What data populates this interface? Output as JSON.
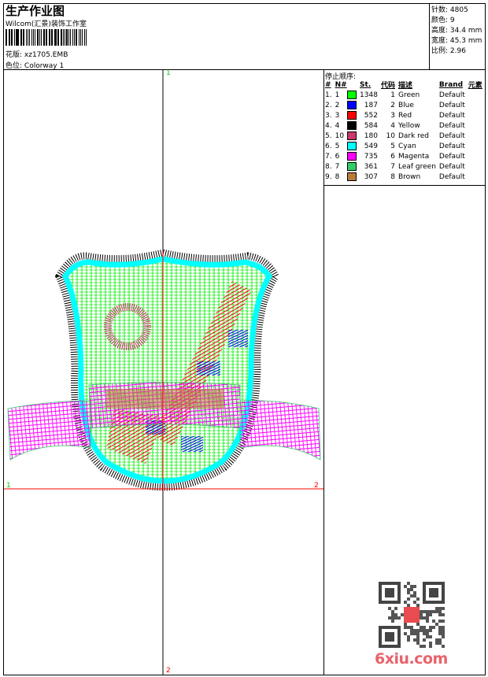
{
  "header": {
    "title": "生产作业图",
    "subtitle": "Wilcom(汇景)装饰工作室",
    "design_label": "花版:",
    "design_value": "xz1705.EMB",
    "colorway_label": "色位:",
    "colorway_value": "Colorway 1"
  },
  "info": [
    {
      "label": "针数:",
      "value": "4805"
    },
    {
      "label": "颜色:",
      "value": "9"
    },
    {
      "label": "高度:",
      "value": "34.4 mm"
    },
    {
      "label": "宽度:",
      "value": "45.3 mm"
    },
    {
      "label": "比例:",
      "value": "2.96"
    }
  ],
  "stop_sequence": {
    "title": "停止顺序:",
    "headers": [
      "#",
      "N#",
      "St.",
      "代码",
      "描述",
      "Brand",
      "元素"
    ],
    "rows": [
      {
        "idx": "1.",
        "n": "1",
        "color": "#00ff00",
        "st": "1348",
        "code": "1",
        "desc": "Green",
        "brand": "Default"
      },
      {
        "idx": "2.",
        "n": "2",
        "color": "#0000ff",
        "st": "187",
        "code": "2",
        "desc": "Blue",
        "brand": "Default"
      },
      {
        "idx": "3.",
        "n": "3",
        "color": "#ff0000",
        "st": "552",
        "code": "3",
        "desc": "Red",
        "brand": "Default"
      },
      {
        "idx": "4.",
        "n": "4",
        "color": "#000000",
        "st": "584",
        "code": "4",
        "desc": "Yellow",
        "brand": "Default"
      },
      {
        "idx": "5.",
        "n": "10",
        "color": "#c8386a",
        "st": "180",
        "code": "10",
        "desc": "Dark red",
        "brand": "Default"
      },
      {
        "idx": "6.",
        "n": "5",
        "color": "#00ffff",
        "st": "549",
        "code": "5",
        "desc": "Cyan",
        "brand": "Default"
      },
      {
        "idx": "7.",
        "n": "6",
        "color": "#ff00ff",
        "st": "735",
        "code": "6",
        "desc": "Magenta",
        "brand": "Default"
      },
      {
        "idx": "8.",
        "n": "7",
        "color": "#33cc66",
        "st": "361",
        "code": "7",
        "desc": "Leaf green",
        "brand": "Default"
      },
      {
        "idx": "9.",
        "n": "8",
        "color": "#b87c3a",
        "st": "307",
        "code": "8",
        "desc": "Brown",
        "brand": "Default"
      }
    ]
  },
  "markers": {
    "top": "1",
    "left": "1",
    "right": "2",
    "bottom": "2"
  },
  "watermark": {
    "text": "6xiu.com",
    "stamp": "以绣图版"
  }
}
